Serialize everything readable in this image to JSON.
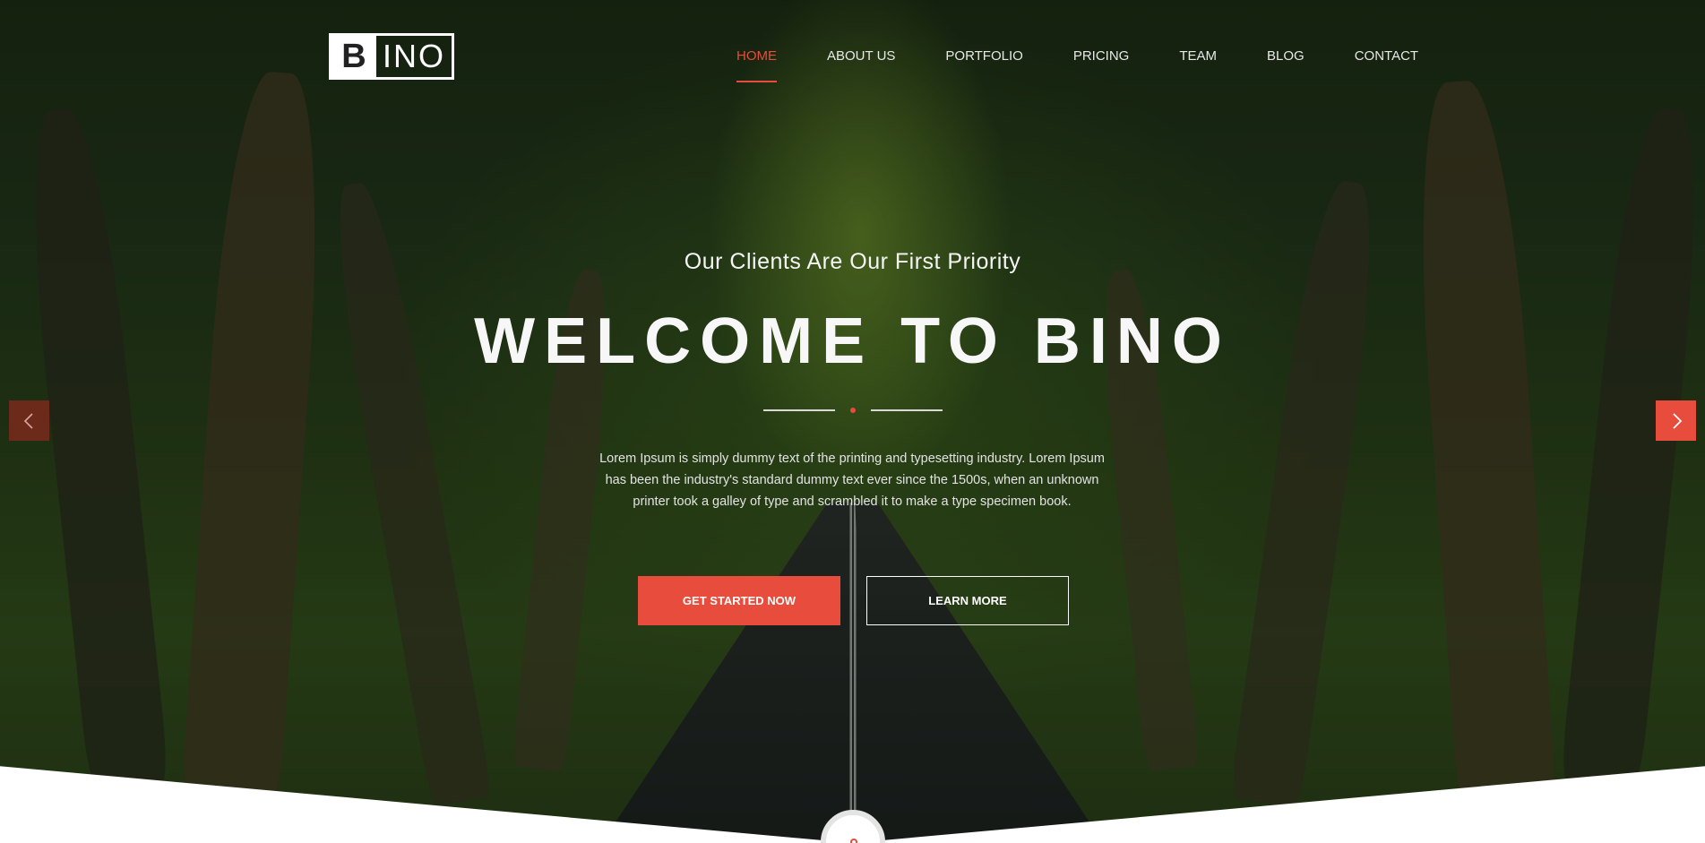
{
  "brand": {
    "logo_letter": "B",
    "logo_rest": "INO",
    "accent_color": "#e74c3c"
  },
  "nav": {
    "items": [
      {
        "label": "HOME",
        "active": true
      },
      {
        "label": "ABOUT US",
        "active": false
      },
      {
        "label": "PORTFOLIO",
        "active": false
      },
      {
        "label": "PRICING",
        "active": false
      },
      {
        "label": "TEAM",
        "active": false
      },
      {
        "label": "BLOG",
        "active": false
      },
      {
        "label": "CONTACT",
        "active": false
      }
    ]
  },
  "hero": {
    "tagline": "Our Clients Are Our First Priority",
    "headline": "WELCOME TO BINO",
    "description": "Lorem Ipsum is simply dummy text of the printing and typesetting industry. Lorem Ipsum has been the industry's standard dummy text ever since the 1500s, when an unknown printer took a galley of type and scrambled it to make a type specimen book.",
    "primary_button": "GET STARTED NOW",
    "secondary_button": "LEARN MORE"
  },
  "icons": {
    "prev": "chevron-left-icon",
    "next": "chevron-right-icon",
    "scroll": "map-marker-icon"
  }
}
